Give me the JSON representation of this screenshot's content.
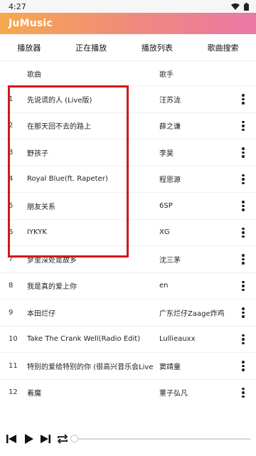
{
  "status_bar": {
    "time": "4:27"
  },
  "app": {
    "title": "JuMusic"
  },
  "tabs": [
    {
      "label": "播放器"
    },
    {
      "label": "正在播放"
    },
    {
      "label": "播放列表"
    },
    {
      "label": "歌曲搜索"
    }
  ],
  "table": {
    "headers": {
      "title": "歌曲",
      "artist": "歌手"
    },
    "rows": [
      {
        "num": "1",
        "title": "先说谎的人 (Live版)",
        "artist": "汪苏泷"
      },
      {
        "num": "2",
        "title": "在那天回不去的路上",
        "artist": "薛之谦"
      },
      {
        "num": "3",
        "title": "野孩子",
        "artist": "李昊"
      },
      {
        "num": "4",
        "title": "Royal Blue(ft. Rapeter)",
        "artist": "程思源"
      },
      {
        "num": "5",
        "title": "朋友关系",
        "artist": "6SP"
      },
      {
        "num": "6",
        "title": "IYKYK",
        "artist": "XG"
      },
      {
        "num": "7",
        "title": "梦里深处是故乡",
        "artist": "沈三茅"
      },
      {
        "num": "8",
        "title": "我是真的爱上你",
        "artist": "en"
      },
      {
        "num": "9",
        "title": "本田烂仔",
        "artist": "广东烂仔Zaage炸鸡"
      },
      {
        "num": "10",
        "title": "Take The Crank Well(Radio Edit)",
        "artist": "Lullieauxx"
      },
      {
        "num": "11",
        "title": "特别的爱给特别的你 (很高兴音乐会Live",
        "artist": "窦靖童"
      },
      {
        "num": "12",
        "title": "着魔",
        "artist": "董子弘凡"
      }
    ]
  },
  "player": {
    "progress_fraction": 0.0
  },
  "colors": {
    "accent_start": "#f5a94e",
    "accent_end": "#ec77a8",
    "highlight": "#d01919"
  }
}
